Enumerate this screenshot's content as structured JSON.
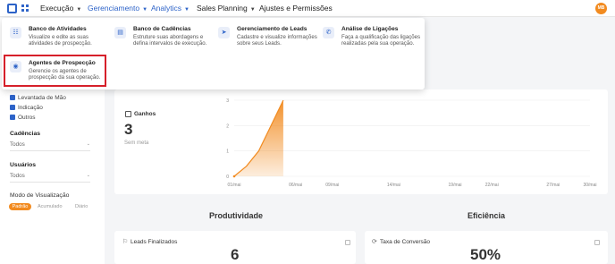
{
  "nav": {
    "items": [
      {
        "label": "Execução",
        "has_chevron": true
      },
      {
        "label": "Gerenciamento",
        "has_chevron": true
      },
      {
        "label": "Analytics",
        "has_chevron": true,
        "active": true
      },
      {
        "label": "Sales Planning",
        "has_chevron": true
      },
      {
        "label": "Ajustes e Permissões",
        "has_chevron": false
      }
    ],
    "avatar_initials": "MB",
    "active_color": "#2d63c8",
    "avatar_color": "#f28b20"
  },
  "dropdown": {
    "items": [
      {
        "title": "Banco de Atividades",
        "description": "Visualize e edite as suas atividades de prospecção.",
        "icon": "sliders-icon"
      },
      {
        "title": "Banco de Cadências",
        "description": "Estruture suas abordagens e defina intervalos de execução.",
        "icon": "layout-icon"
      },
      {
        "title": "Gerenciamento de Leads",
        "description": "Cadastre e visualize informações sobre seus Leads.",
        "icon": "pointer-icon"
      },
      {
        "title": "Análise de Ligações",
        "description": "Faça a qualificação das ligações realizadas pela sua operação.",
        "icon": "phone-icon"
      },
      {
        "title": "Agentes de Prospecção",
        "description": "Gerencie os agentes de prospecção da sua operação.",
        "icon": "agent-icon",
        "highlighted": true
      }
    ]
  },
  "sidebar": {
    "checkbox_items": [
      "Levantada de Mão",
      "Indicação",
      "Outros"
    ],
    "cadencias": {
      "label": "Cadências",
      "value": "Todos"
    },
    "usuarios": {
      "label": "Usuários",
      "value": "Todos"
    },
    "modo": {
      "label": "Modo de Visualização",
      "options": [
        "Padrão",
        "Acumulado",
        "Diário"
      ],
      "selected": "Padrão"
    }
  },
  "ganhos": {
    "title": "Ganhos",
    "value": "3",
    "subtitle": "Sem meta"
  },
  "chart_data": {
    "type": "area",
    "x": [
      "01/mai",
      "02/mai",
      "03/mai",
      "04/mai",
      "05/mai",
      "06/mai"
    ],
    "values": [
      0,
      0.4,
      1,
      2,
      3,
      null
    ],
    "x_tick_labels": [
      "01/mai",
      "06/mai",
      "09/mai",
      "14/mai",
      "19/mai",
      "22/mai",
      "27/mai",
      "30/mai"
    ],
    "y_tick_labels": [
      "0",
      "1",
      "2",
      "3"
    ],
    "ylim": [
      0,
      3
    ],
    "color": "#f28b20"
  },
  "produtividade": {
    "title": "Produtividade",
    "metric": "Leads Finalizados",
    "value": "6"
  },
  "eficiencia": {
    "title": "Eficiência",
    "metric": "Taxa de Conversão",
    "value": "50%"
  }
}
